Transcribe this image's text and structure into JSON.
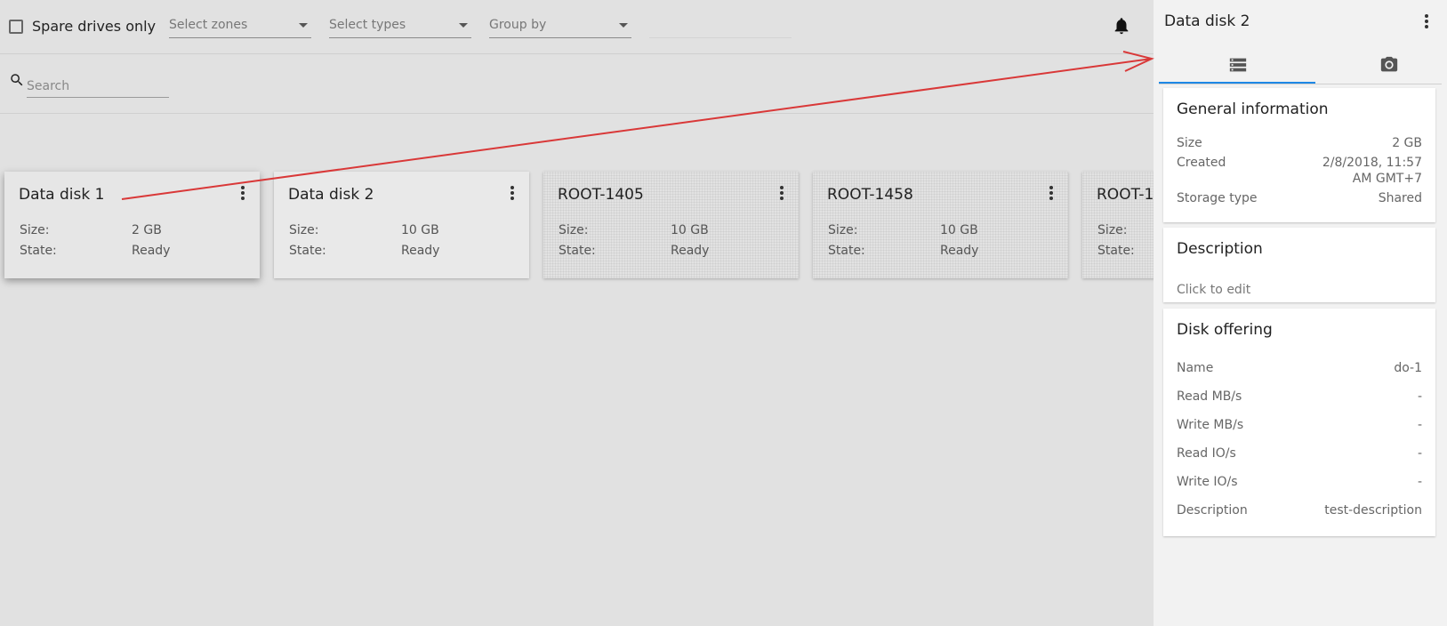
{
  "toolbar": {
    "spare_label": "Spare drives only",
    "zones_placeholder": "Select zones",
    "types_placeholder": "Select types",
    "group_placeholder": "Group by"
  },
  "search": {
    "placeholder": "Search"
  },
  "cards": [
    {
      "title": "Data disk 1",
      "size_label": "Size:",
      "size": "2 GB",
      "state_label": "State:",
      "state": "Ready"
    },
    {
      "title": "Data disk 2",
      "size_label": "Size:",
      "size": "10 GB",
      "state_label": "State:",
      "state": "Ready"
    },
    {
      "title": "ROOT-1405",
      "size_label": "Size:",
      "size": "10 GB",
      "state_label": "State:",
      "state": "Ready"
    },
    {
      "title": "ROOT-1458",
      "size_label": "Size:",
      "size": "10 GB",
      "state_label": "State:",
      "state": "Ready"
    },
    {
      "title": "ROOT-1",
      "size_label": "Size:",
      "size": "",
      "state_label": "State:",
      "state": ""
    }
  ],
  "panel": {
    "title": "Data disk 2",
    "tabs": [
      "storage-list-icon",
      "camera-icon"
    ],
    "general": {
      "heading": "General information",
      "size_label": "Size",
      "size": "2 GB",
      "created_label": "Created",
      "created_line1": "2/8/2018, 11:57",
      "created_line2": "AM GMT+7",
      "storage_label": "Storage type",
      "storage": "Shared"
    },
    "description": {
      "heading": "Description",
      "value": "Click to edit"
    },
    "offering": {
      "heading": "Disk offering",
      "rows": [
        {
          "label": "Name",
          "value": "do-1"
        },
        {
          "label": "Read MB/s",
          "value": "-"
        },
        {
          "label": "Write MB/s",
          "value": "-"
        },
        {
          "label": "Read IO/s",
          "value": "-"
        },
        {
          "label": "Write IO/s",
          "value": "-"
        },
        {
          "label": "Description",
          "value": "test-description"
        }
      ]
    }
  },
  "colors": {
    "accent": "#1e88e5",
    "annotation_arrow": "#d93838"
  }
}
